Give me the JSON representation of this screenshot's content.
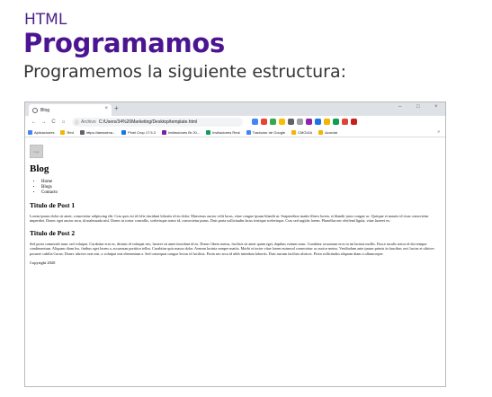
{
  "slide": {
    "kicker": "HTML",
    "title": "Programamos",
    "subtitle": "Programemos la siguiente estructura:"
  },
  "browser": {
    "tab_title": "Blog",
    "tab_close": "×",
    "new_tab": "+",
    "window_controls": {
      "minimize": "–",
      "maximize": "□",
      "close": "×"
    },
    "nav": {
      "back": "←",
      "forward": "→",
      "reload": "C",
      "home": "⌂"
    },
    "omnibox": {
      "info": "ⓘ",
      "label": "Archivo",
      "url": "C:/Users/34%20Marketing/Desktop/template.html"
    },
    "extension_colors": [
      "#4285f4",
      "#ea4335",
      "#34a853",
      "#fbbc05",
      "#5f6368",
      "#9aa0a6",
      "#8e24aa",
      "#1a73e8",
      "#f4b400",
      "#0f9d58",
      "#db4437",
      "#c5221f"
    ],
    "bookmarks": [
      {
        "label": "Aplicaciones",
        "color": "#4285f4"
      },
      {
        "label": "Red",
        "color": "#f4b400"
      },
      {
        "label": "https://lamaxima...",
        "color": "#5f6368"
      },
      {
        "label": "Pixel Crop 17.5.3",
        "color": "#1a73e8"
      },
      {
        "label": "Invitaciones Br 20...",
        "color": "#7b1fa2"
      },
      {
        "label": "Invitaciones Real",
        "color": "#0f9d58"
      },
      {
        "label": "Traductor de Google",
        "color": "#4285f4"
      },
      {
        "label": "CMGUIA",
        "color": "#f4b400"
      },
      {
        "label": "Acordar",
        "color": "#f4b400"
      }
    ],
    "bookmarks_more": "»"
  },
  "page": {
    "logo_alt": "Logo",
    "blog_title": "Blog",
    "menu": [
      "Home",
      "Blogs",
      "Contacto"
    ],
    "posts": [
      {
        "title": "Titulo de Post 1",
        "body": "Lorem ipsum dolor sit amet, consectetur adipiscing elit. Cras quis est id felis tincidunt lobortis id eu dolor. Maecenas auctor velit lacus, vitae congue ipsum blandit ut. Suspendisse mattis libero lorem, et blandit justo congue ac. Quisque et mauris id risus consectetur imperdiet. Donec eget auctor arcu, id malesuada nisl. Donec in tortor convallis, scelerisque tortor id, consectetur purus. Duis porta sollicitudin lacus tristique scelerisque. Cras sed sagittis lorem. Phasellus nec eleifend ligula, vitae laoreet ex."
      },
      {
        "title": "Titulo de Post 2",
        "body": "Sed porta commodo nunc sed volutpat. Curabitur erat ex, dictum id volutpat nec, laoreet sit amet tincidunt id eu. Donec libero metus, facilisis sit amet quam eget, dapibus rutrum nunc. Curabitur accumsan eros in mi lacinia mollis. Fusce iaculis tortor id dui tempor condimentum. Aliquam diam leo, finibus eget lorem a, accumsan porttitor tellus. Curabitur quis massa dolor. Aenean lacinia semper mattis. Morbi et tortor vitae lorem euismod consectetur ac auctor metus. Vestibulum ante ipsum primis in faucibus orci luctus et ultrices posuere cubilia Curae; Donec ultrices erat nisi, a volutpat erat elementum a. Sed consequat congue lectus id facilisis. Proin nec arcu id nibh interdum lobortis. Duis rutrum facilisis ultrices. Proin sollicitudin aliquam diam a ullamcorper."
      }
    ],
    "copyright": "Copyright 2020"
  }
}
